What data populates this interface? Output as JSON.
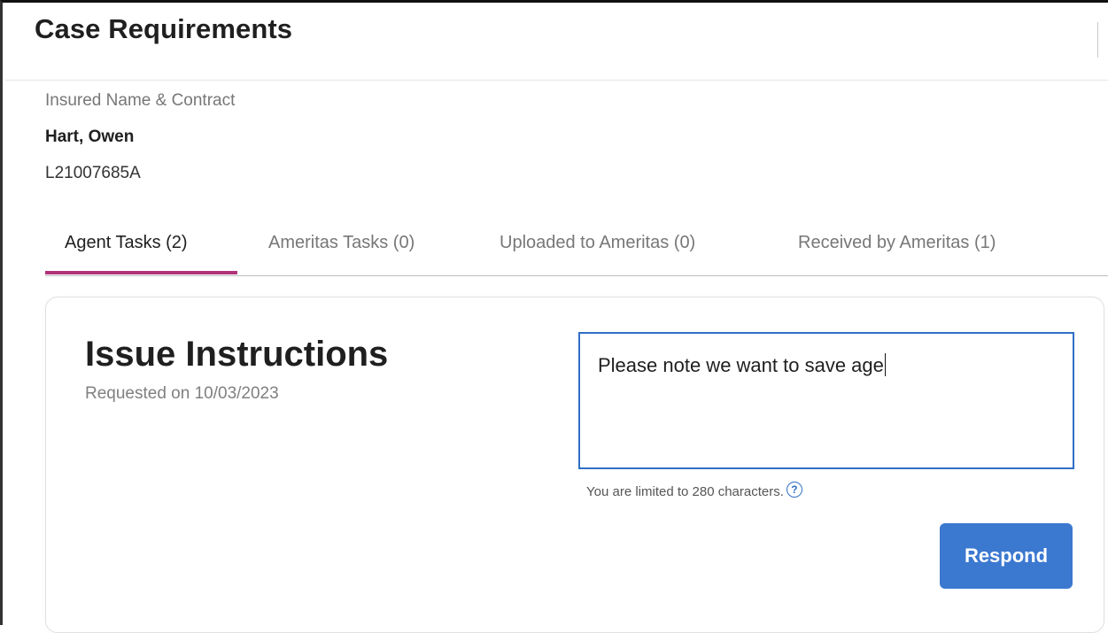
{
  "header": {
    "title": "Case Requirements"
  },
  "insured": {
    "label": "Insured Name & Contract",
    "name": "Hart, Owen",
    "contract": "L21007685A"
  },
  "tabs": [
    {
      "label": "Agent Tasks (2)",
      "active": true
    },
    {
      "label": "Ameritas Tasks (0)",
      "active": false
    },
    {
      "label": "Uploaded to Ameritas (0)",
      "active": false
    },
    {
      "label": "Received by Ameritas (1)",
      "active": false
    }
  ],
  "task": {
    "title": "Issue Instructions",
    "requested": "Requested on 10/03/2023",
    "response_value": "Please note we want to save age",
    "limit_hint": "You are limited to 280 characters.",
    "help_icon": "question-circle-icon",
    "respond_label": "Respond"
  },
  "colors": {
    "accent_tab": "#b0337a",
    "primary_button": "#3b78d0",
    "input_border": "#2f6fc6"
  }
}
